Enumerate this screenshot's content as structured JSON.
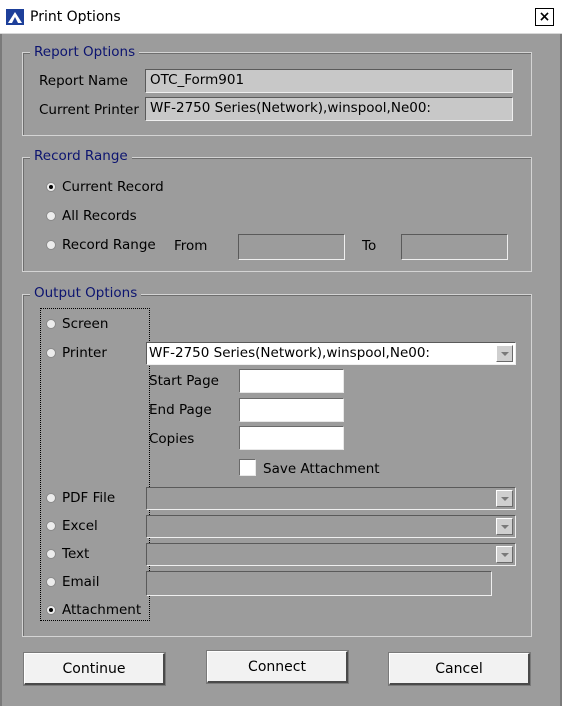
{
  "window": {
    "title": "Print Options",
    "close_label": "×"
  },
  "report_options": {
    "legend": "Report Options",
    "report_name_label": "Report Name",
    "report_name_value": "OTC_Form901",
    "current_printer_label": "Current Printer",
    "current_printer_value": "WF-2750 Series(Network),winspool,Ne00:"
  },
  "record_range": {
    "legend": "Record Range",
    "current_record": "Current Record",
    "all_records": "All Records",
    "record_range": "Record Range",
    "from_label": "From",
    "to_label": "To",
    "from_value": "",
    "to_value": "",
    "selected": "current_record"
  },
  "output_options": {
    "legend": "Output Options",
    "screen": "Screen",
    "printer": "Printer",
    "printer_value": "WF-2750 Series(Network),winspool,Ne00:",
    "start_page_label": "Start Page",
    "end_page_label": "End Page",
    "copies_label": "Copies",
    "save_attachment_label": "Save Attachment",
    "pdf_file": "PDF File",
    "excel": "Excel",
    "text": "Text",
    "email": "Email",
    "attachment": "Attachment",
    "selected": "attachment"
  },
  "buttons": {
    "continue": "Continue",
    "connect": "Connect",
    "cancel": "Cancel"
  },
  "colors": {
    "dialog_bg": "#9c9c9c",
    "legend_text": "#0c1470"
  }
}
